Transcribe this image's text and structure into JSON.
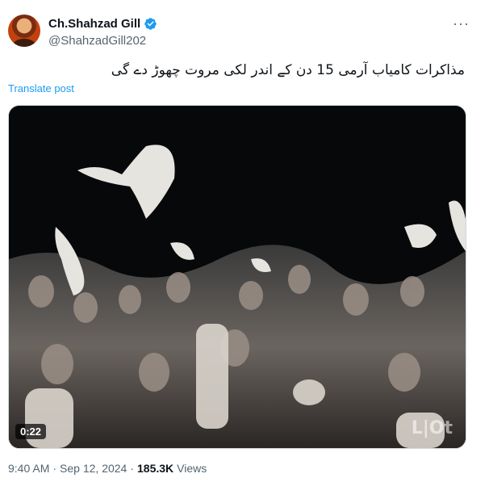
{
  "author": {
    "display_name": "Ch.Shahzad Gill",
    "handle": "@ShahzadGill202",
    "verified_color": "#1d9bf0"
  },
  "more_icon": "more-horizontal-icon",
  "tweet": {
    "text": "مذاکرات کامیاب آرمی 15 دن کے اندر لکی مروت چھوڑ دے گی",
    "translate_label": "Translate post"
  },
  "media": {
    "type": "video",
    "duration": "0:22",
    "watermark": "L|Ot"
  },
  "meta": {
    "time": "9:40 AM",
    "separator1": "·",
    "date": "Sep 12, 2024",
    "separator2": "·",
    "views_count": "185.3K",
    "views_label": "Views"
  }
}
